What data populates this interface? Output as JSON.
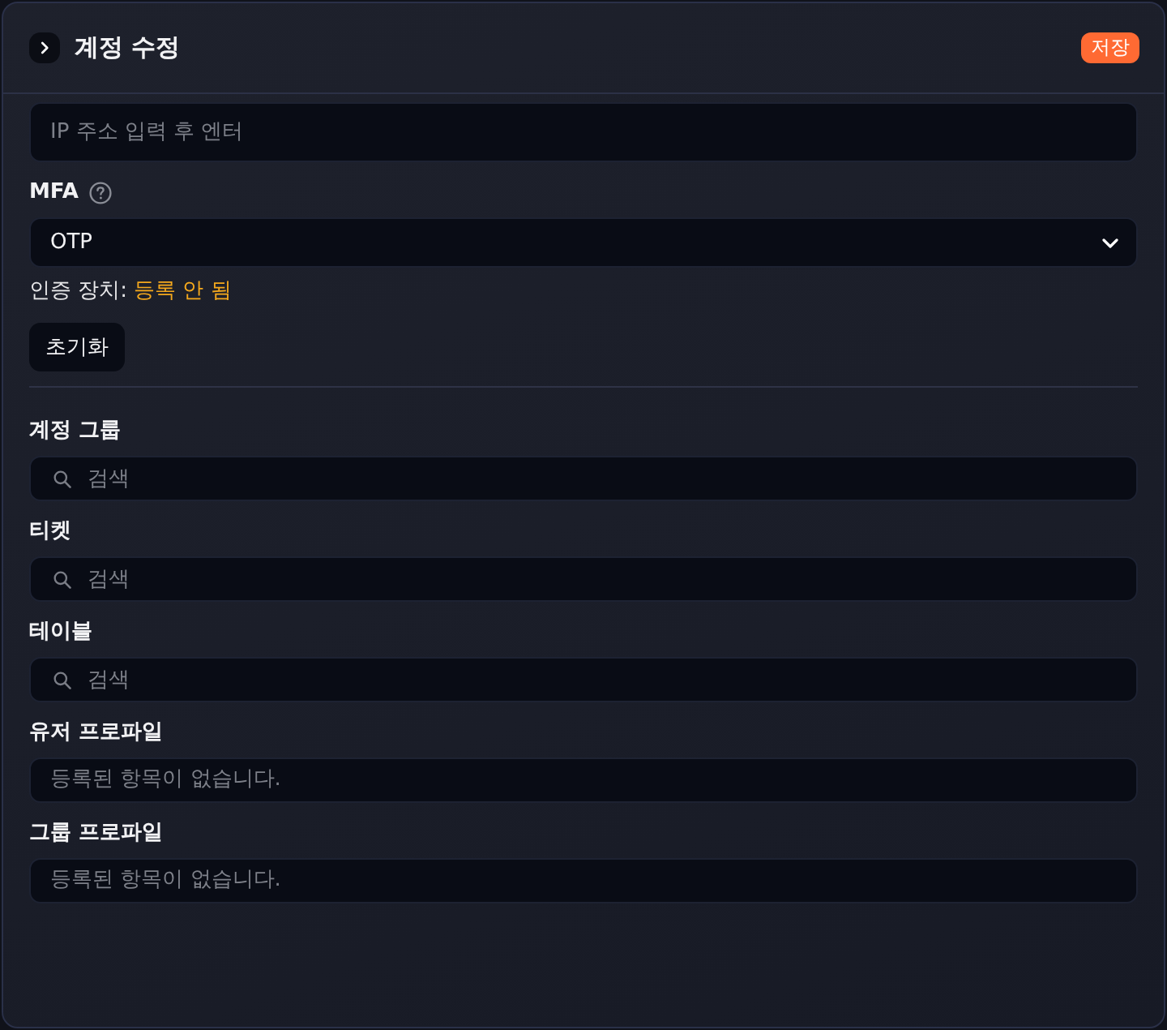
{
  "panel": {
    "title": "계정 수정",
    "save_button": "저장"
  },
  "ip_field": {
    "placeholder": "IP 주소 입력 후 엔터"
  },
  "mfa": {
    "label": "MFA",
    "select_value": "OTP",
    "device_label": "인증 장치:",
    "device_status": "등록 안 됨",
    "reset_button": "초기화"
  },
  "sections": [
    {
      "label": "계정 그룹",
      "kind": "search",
      "placeholder": "검색"
    },
    {
      "label": "티켓",
      "kind": "search",
      "placeholder": "검색"
    },
    {
      "label": "테이블",
      "kind": "search",
      "placeholder": "검색"
    },
    {
      "label": "유저 프로파일",
      "kind": "empty",
      "text": "등록된 항목이 없습니다."
    },
    {
      "label": "그룹 프로파일",
      "kind": "empty",
      "text": "등록된 항목이 없습니다."
    }
  ]
}
